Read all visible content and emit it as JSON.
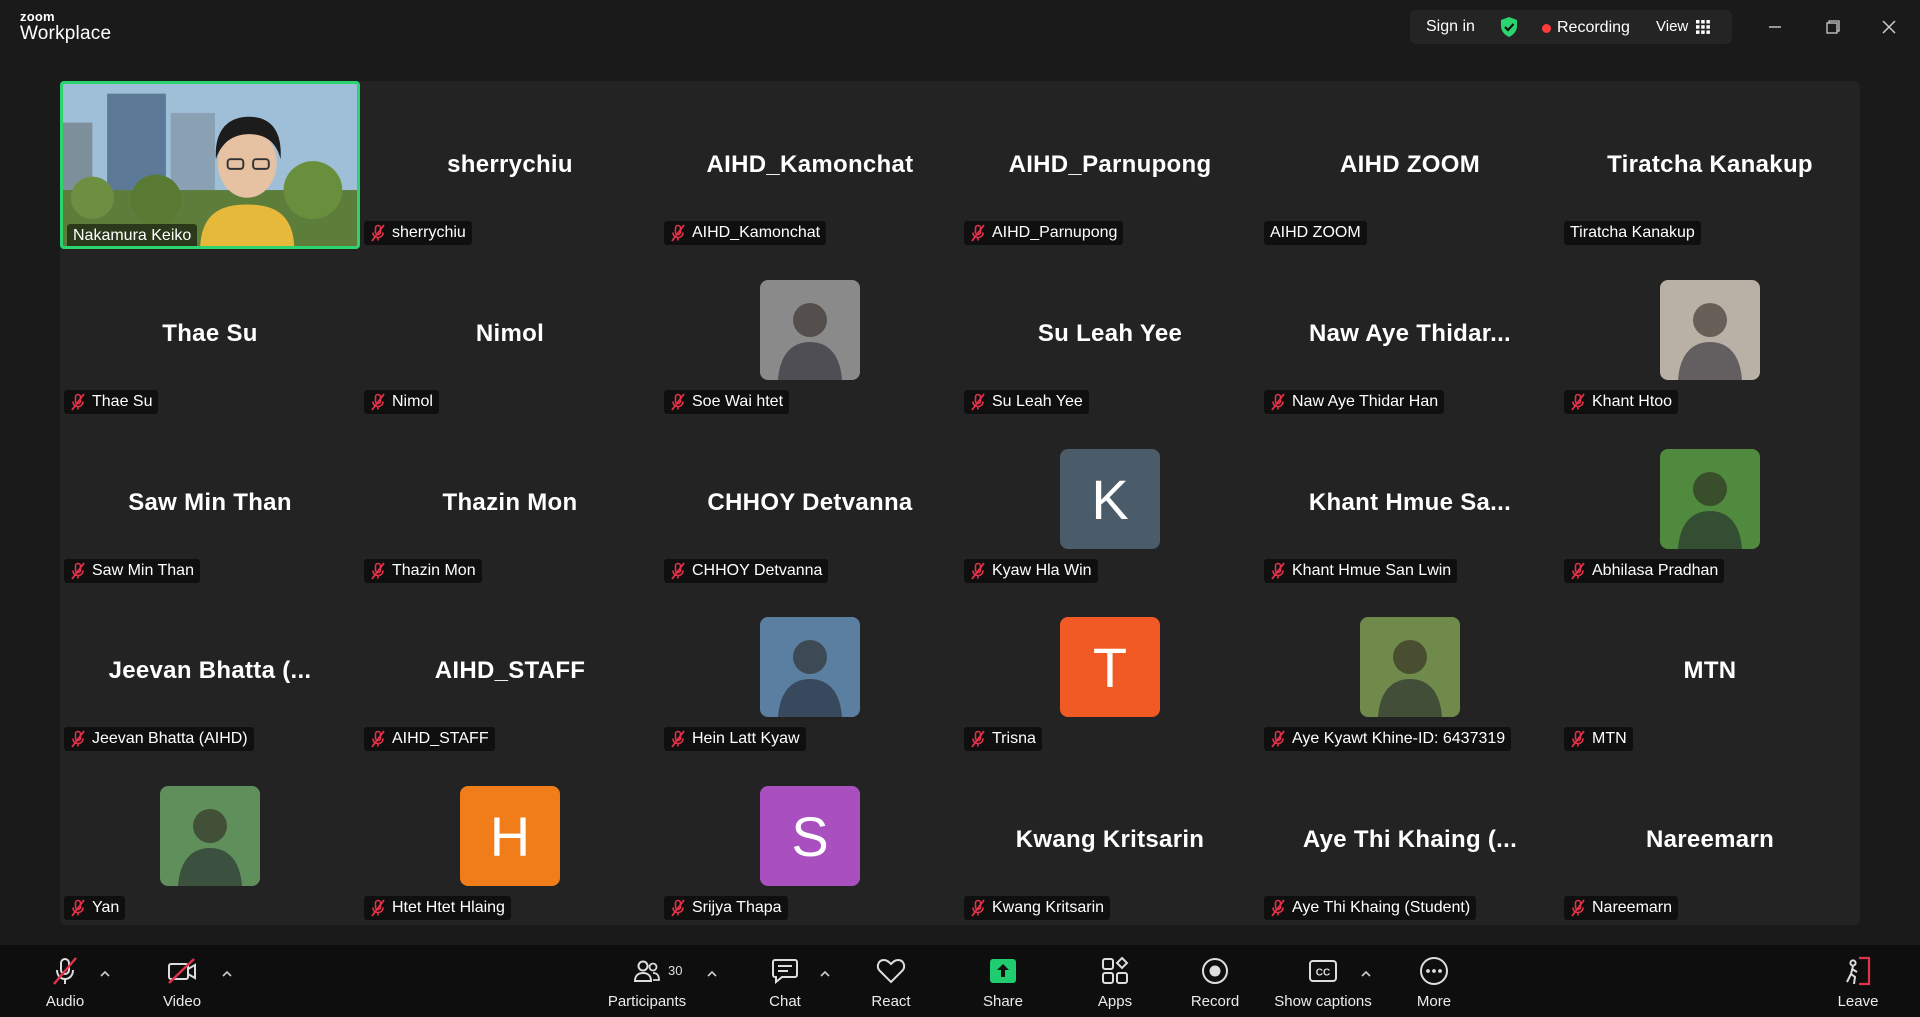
{
  "app": {
    "brand_small": "zoom",
    "brand_large": "Workplace"
  },
  "titlebar": {
    "sign_in": "Sign in",
    "recording": "Recording",
    "view": "View",
    "icons": [
      "shield-check-icon",
      "grid-icon",
      "minimize-icon",
      "restore-icon",
      "close-icon"
    ]
  },
  "participants": [
    {
      "name": "Nakamura Keiko",
      "display": "",
      "muted": false,
      "kind": "video"
    },
    {
      "name": "sherrychiu",
      "display": "sherrychiu",
      "muted": true,
      "kind": "text"
    },
    {
      "name": "AIHD_Kamonchat",
      "display": "AIHD_Kamonchat",
      "muted": true,
      "kind": "text"
    },
    {
      "name": "AIHD_Parnupong",
      "display": "AIHD_Parnupong",
      "muted": true,
      "kind": "text"
    },
    {
      "name": "AIHD ZOOM",
      "display": "AIHD ZOOM",
      "muted": false,
      "kind": "text"
    },
    {
      "name": "Tiratcha Kanakup",
      "display": "Tiratcha Kanakup",
      "muted": false,
      "kind": "text"
    },
    {
      "name": "Thae Su",
      "display": "Thae Su",
      "muted": true,
      "kind": "text"
    },
    {
      "name": "Nimol",
      "display": "Nimol",
      "muted": true,
      "kind": "text"
    },
    {
      "name": "Soe Wai htet",
      "display": "",
      "muted": true,
      "kind": "photo",
      "color": "#8a8a8a"
    },
    {
      "name": "Su Leah Yee",
      "display": "Su Leah Yee",
      "muted": true,
      "kind": "text"
    },
    {
      "name": "Naw Aye Thidar Han",
      "display": "Naw Aye Thidar...",
      "muted": true,
      "kind": "text"
    },
    {
      "name": "Khant Htoo",
      "display": "",
      "muted": true,
      "kind": "photo",
      "color": "#b9b0a6"
    },
    {
      "name": "Saw Min Than",
      "display": "Saw Min Than",
      "muted": true,
      "kind": "text"
    },
    {
      "name": "Thazin Mon",
      "display": "Thazin Mon",
      "muted": true,
      "kind": "text"
    },
    {
      "name": "CHHOY Detvanna",
      "display": "CHHOY Detvanna",
      "muted": true,
      "kind": "text"
    },
    {
      "name": "Kyaw Hla Win",
      "display": "K",
      "muted": true,
      "kind": "letter",
      "color": "#4a5b69"
    },
    {
      "name": "Khant Hmue San Lwin",
      "display": "Khant Hmue Sa...",
      "muted": true,
      "kind": "text"
    },
    {
      "name": "Abhilasa Pradhan",
      "display": "",
      "muted": true,
      "kind": "photo",
      "color": "#4f8a3e"
    },
    {
      "name": "Jeevan Bhatta (AIHD)",
      "display": "Jeevan Bhatta (...",
      "muted": true,
      "kind": "text"
    },
    {
      "name": "AIHD_STAFF",
      "display": "AIHD_STAFF",
      "muted": true,
      "kind": "text"
    },
    {
      "name": "Hein Latt Kyaw",
      "display": "",
      "muted": true,
      "kind": "photo",
      "color": "#5a7fa0"
    },
    {
      "name": "Trisna",
      "display": "T",
      "muted": true,
      "kind": "letter",
      "color": "#f15a24"
    },
    {
      "name": "Aye Kyawt Khine-ID: 6437319",
      "display": "",
      "muted": true,
      "kind": "photo",
      "color": "#6f8a4b"
    },
    {
      "name": "MTN",
      "display": "MTN",
      "muted": true,
      "kind": "text"
    },
    {
      "name": "Yan",
      "display": "",
      "muted": true,
      "kind": "photo",
      "color": "#5f8f5a"
    },
    {
      "name": "Htet Htet Hlaing",
      "display": "H",
      "muted": true,
      "kind": "letter",
      "color": "#f07d1a"
    },
    {
      "name": "Srijya Thapa",
      "display": "S",
      "muted": true,
      "kind": "letter",
      "color": "#a94fc0"
    },
    {
      "name": "Kwang Kritsarin",
      "display": "Kwang Kritsarin",
      "muted": true,
      "kind": "text"
    },
    {
      "name": "Aye Thi Khaing (Student)",
      "display": "Aye Thi Khaing (...",
      "muted": true,
      "kind": "text"
    },
    {
      "name": "Nareemarn",
      "display": "Nareemarn",
      "muted": true,
      "kind": "text"
    }
  ],
  "toolbar": {
    "audio": "Audio",
    "video": "Video",
    "participants": "Participants",
    "participants_count": "30",
    "chat": "Chat",
    "react": "React",
    "share": "Share",
    "apps": "Apps",
    "record": "Record",
    "captions": "Show captions",
    "more": "More",
    "leave": "Leave",
    "share_color": "#1fcc6f",
    "leave_color": "#e3334b"
  }
}
